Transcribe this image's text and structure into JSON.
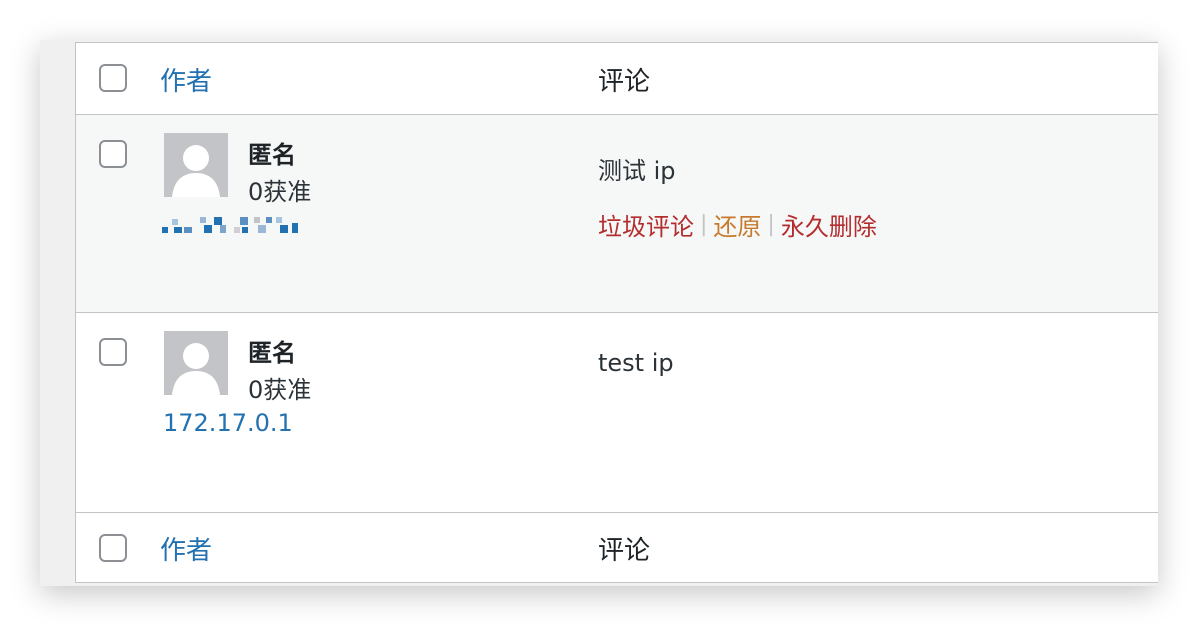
{
  "colors": {
    "link": "#2271b1",
    "spam": "#b32d2e",
    "restore": "#c77a2e",
    "delete": "#b32d2e"
  },
  "header": {
    "author_label": "作者",
    "comment_label": "评论"
  },
  "footer": {
    "author_label": "作者",
    "comment_label": "评论"
  },
  "rows": [
    {
      "author_name": "匿名",
      "approved_count": "0获准",
      "comment": "测试 ip",
      "actions": {
        "spam": "垃圾评论",
        "restore": "还原",
        "delete": "永久删除"
      }
    },
    {
      "author_name": "匿名",
      "approved_count": "0获准",
      "ip": "172.17.0.1",
      "comment": "test ip"
    }
  ]
}
